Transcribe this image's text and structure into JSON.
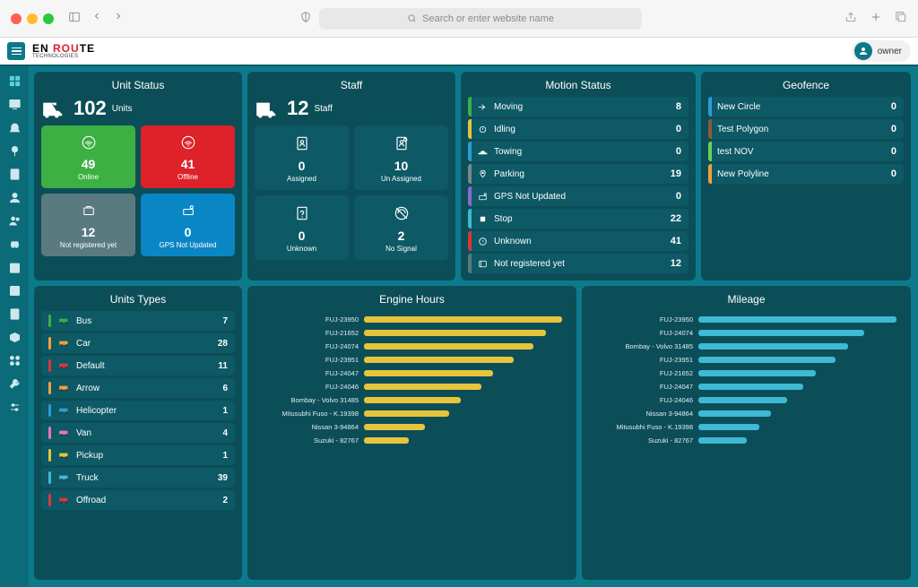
{
  "browser_chrome": {
    "search_placeholder": "Search or enter website name"
  },
  "topbar": {
    "logo_top": "EN ROUTE",
    "logo_bottom": "TECHNOLOGIES",
    "user_label": "owner"
  },
  "unit_status": {
    "title": "Unit Status",
    "count": "102",
    "count_label": "Units",
    "tiles": [
      {
        "count": "49",
        "label": "Online"
      },
      {
        "count": "41",
        "label": "Offline"
      },
      {
        "count": "12",
        "label": "Not registered yet"
      },
      {
        "count": "0",
        "label": "GPS Not Updated"
      }
    ]
  },
  "staff": {
    "title": "Staff",
    "count": "12",
    "count_label": "Staff",
    "tiles": [
      {
        "count": "0",
        "label": "Assigned"
      },
      {
        "count": "10",
        "label": "Un Assigned"
      },
      {
        "count": "0",
        "label": "Unknown"
      },
      {
        "count": "2",
        "label": "No Signal"
      }
    ]
  },
  "motion_status": {
    "title": "Motion Status",
    "items": [
      {
        "label": "Moving",
        "value": "8",
        "color": "#3cb043"
      },
      {
        "label": "Idling",
        "value": "0",
        "color": "#e6c53c"
      },
      {
        "label": "Towing",
        "value": "0",
        "color": "#2a9cd6"
      },
      {
        "label": "Parking",
        "value": "19",
        "color": "#7a8a8c"
      },
      {
        "label": "GPS Not Updated",
        "value": "0",
        "color": "#8b6ad1"
      },
      {
        "label": "Stop",
        "value": "22",
        "color": "#3fb9d4"
      },
      {
        "label": "Unknown",
        "value": "41",
        "color": "#d93838"
      },
      {
        "label": "Not registered yet",
        "value": "12",
        "color": "#5a7a80"
      }
    ]
  },
  "geofence": {
    "title": "Geofence",
    "items": [
      {
        "label": "New Circle",
        "value": "0",
        "color": "#2a9cd6"
      },
      {
        "label": "Test Polygon",
        "value": "0",
        "color": "#8b5a3c"
      },
      {
        "label": "test NOV",
        "value": "0",
        "color": "#6bd15a"
      },
      {
        "label": "New Polyline",
        "value": "0",
        "color": "#f2a03d"
      }
    ]
  },
  "unit_types": {
    "title": "Units Types",
    "items": [
      {
        "label": "Bus",
        "value": "7",
        "color": "#3cb043"
      },
      {
        "label": "Car",
        "value": "28",
        "color": "#f2a03d"
      },
      {
        "label": "Default",
        "value": "11",
        "color": "#d93838"
      },
      {
        "label": "Arrow",
        "value": "6",
        "color": "#f2a03d"
      },
      {
        "label": "Helicopter",
        "value": "1",
        "color": "#2a9cd6"
      },
      {
        "label": "Van",
        "value": "4",
        "color": "#e47ab0"
      },
      {
        "label": "Pickup",
        "value": "1",
        "color": "#e6c53c"
      },
      {
        "label": "Truck",
        "value": "39",
        "color": "#3fb9d4"
      },
      {
        "label": "Offroad",
        "value": "2",
        "color": "#d93838"
      }
    ]
  },
  "engine_hours": {
    "title": "Engine Hours",
    "items": [
      {
        "label": "FUJ-23950"
      },
      {
        "label": "FUJ-21652"
      },
      {
        "label": "FUJ-24074"
      },
      {
        "label": "FUJ-23951"
      },
      {
        "label": "FUJ-24047"
      },
      {
        "label": "FUJ-24046"
      },
      {
        "label": "Bombay - Volvo 31485"
      },
      {
        "label": "Mitusubhi Fuso - K.19398"
      },
      {
        "label": "Nissan 3-94864"
      },
      {
        "label": "Suzuki - 82767"
      }
    ]
  },
  "mileage": {
    "title": "Mileage",
    "items": [
      {
        "label": "FUJ-23950"
      },
      {
        "label": "FUJ-24074"
      },
      {
        "label": "Bombay - Volvo 31485"
      },
      {
        "label": "FUJ-23951"
      },
      {
        "label": "FUJ-21652"
      },
      {
        "label": "FUJ-24047"
      },
      {
        "label": "FUJ-24046"
      },
      {
        "label": "Nissan 3-94864"
      },
      {
        "label": "Mitusubhi Fuso - K.19398"
      },
      {
        "label": "Suzuki - 82767"
      }
    ]
  },
  "chart_data": [
    {
      "type": "bar",
      "title": "Engine Hours",
      "categories": [
        "FUJ-23950",
        "FUJ-21652",
        "FUJ-24074",
        "FUJ-23951",
        "FUJ-24047",
        "FUJ-24046",
        "Bombay - Volvo 31485",
        "Mitusubhi Fuso - K.19398",
        "Nissan 3-94864",
        "Suzuki - 82767"
      ],
      "values": [
        98,
        90,
        84,
        74,
        64,
        58,
        48,
        42,
        30,
        22
      ],
      "xlabel": "",
      "ylabel": "",
      "ylim": [
        0,
        100
      ]
    },
    {
      "type": "bar",
      "title": "Mileage",
      "categories": [
        "FUJ-23950",
        "FUJ-24074",
        "Bombay - Volvo 31485",
        "FUJ-23951",
        "FUJ-21652",
        "FUJ-24047",
        "FUJ-24046",
        "Nissan 3-94864",
        "Mitusubhi Fuso - K.19398",
        "Suzuki - 82767"
      ],
      "values": [
        98,
        82,
        74,
        68,
        58,
        52,
        44,
        36,
        30,
        24
      ],
      "xlabel": "",
      "ylabel": "",
      "ylim": [
        0,
        100
      ]
    }
  ]
}
